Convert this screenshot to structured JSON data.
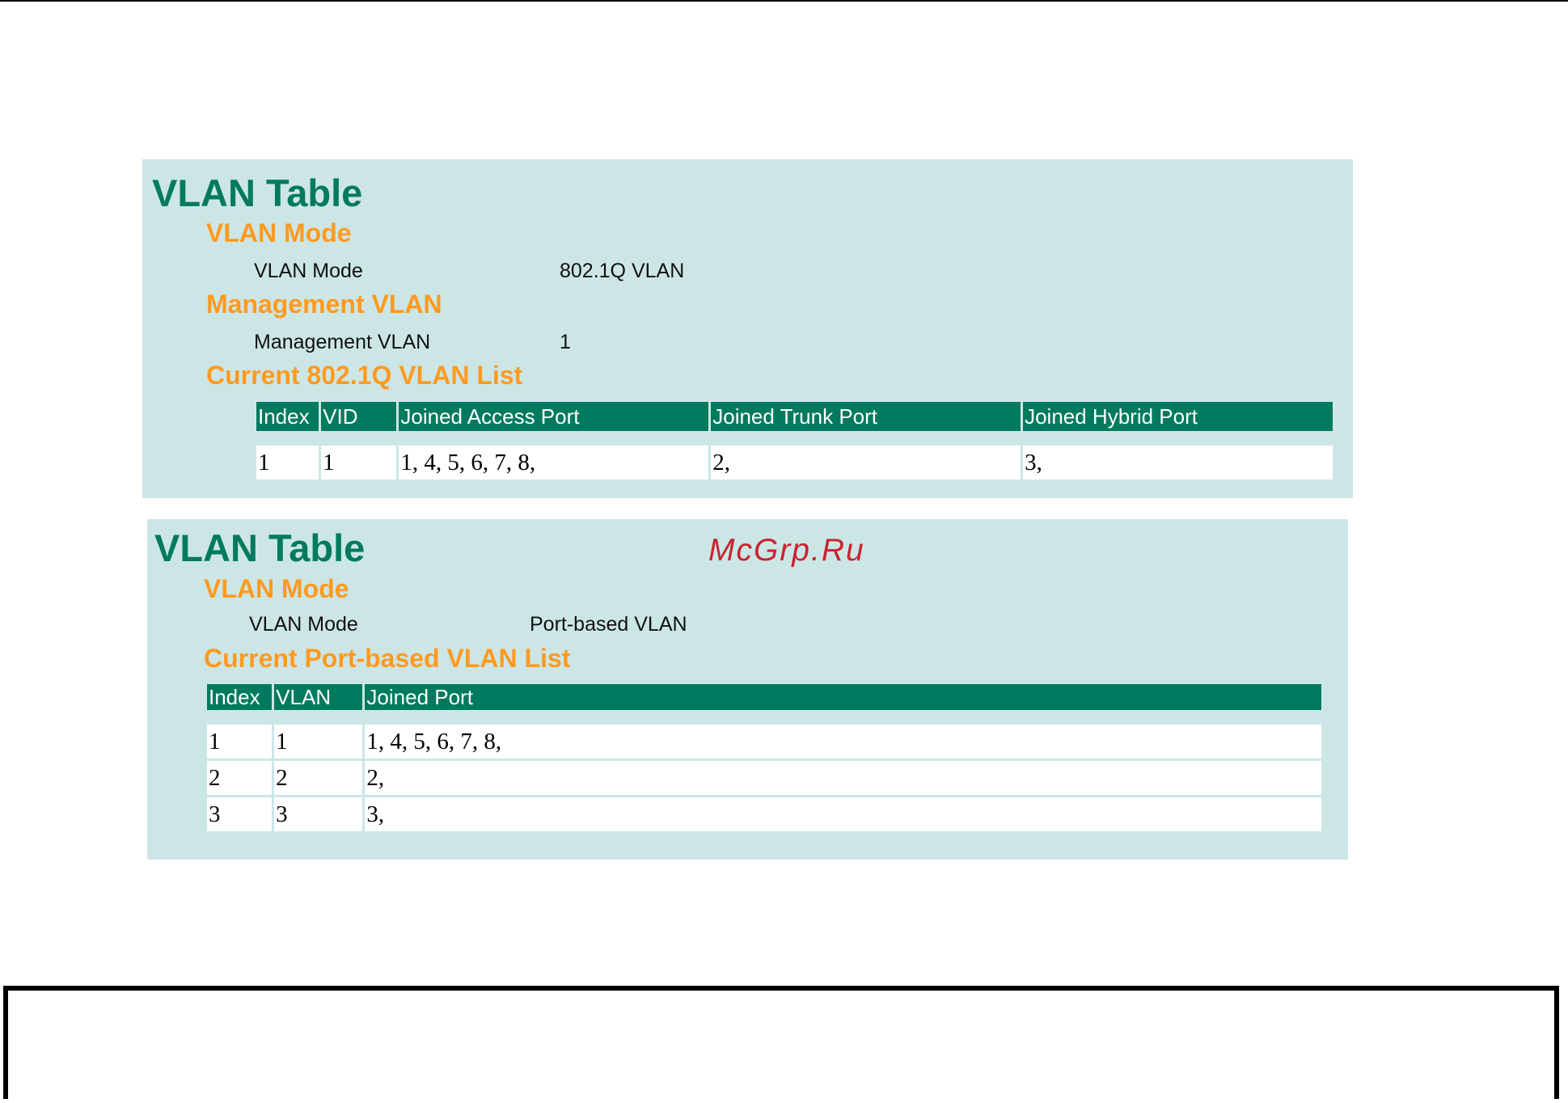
{
  "panel_8021q": {
    "title": "VLAN Table",
    "vlan_mode_heading": "VLAN Mode",
    "vlan_mode_label": "VLAN Mode",
    "vlan_mode_value": "802.1Q VLAN",
    "mgmt_heading": "Management VLAN",
    "mgmt_label": "Management VLAN",
    "mgmt_value": "1",
    "list_heading": "Current 802.1Q VLAN List",
    "table": {
      "headers": [
        "Index",
        "VID",
        "Joined Access Port",
        "Joined Trunk Port",
        "Joined Hybrid Port"
      ],
      "rows": [
        [
          "1",
          "1",
          "1, 4, 5, 6, 7, 8,",
          "2,",
          "3,"
        ]
      ]
    }
  },
  "panel_port_based": {
    "title": "VLAN Table",
    "vlan_mode_heading": "VLAN Mode",
    "vlan_mode_label": "VLAN Mode",
    "vlan_mode_value": "Port-based VLAN",
    "list_heading": "Current Port-based VLAN List",
    "table": {
      "headers": [
        "Index",
        "VLAN",
        "Joined Port"
      ],
      "rows": [
        [
          "1",
          "1",
          "1, 4, 5, 6, 7, 8,"
        ],
        [
          "2",
          "2",
          "2,"
        ],
        [
          "3",
          "3",
          "3,"
        ]
      ]
    }
  },
  "watermark": "McGrp.Ru",
  "colors": {
    "panel_bg": "#cce6e6",
    "title": "#007a5e",
    "section": "#ff9a1f",
    "header_bg": "#007a5e",
    "watermark": "#c8232f"
  }
}
